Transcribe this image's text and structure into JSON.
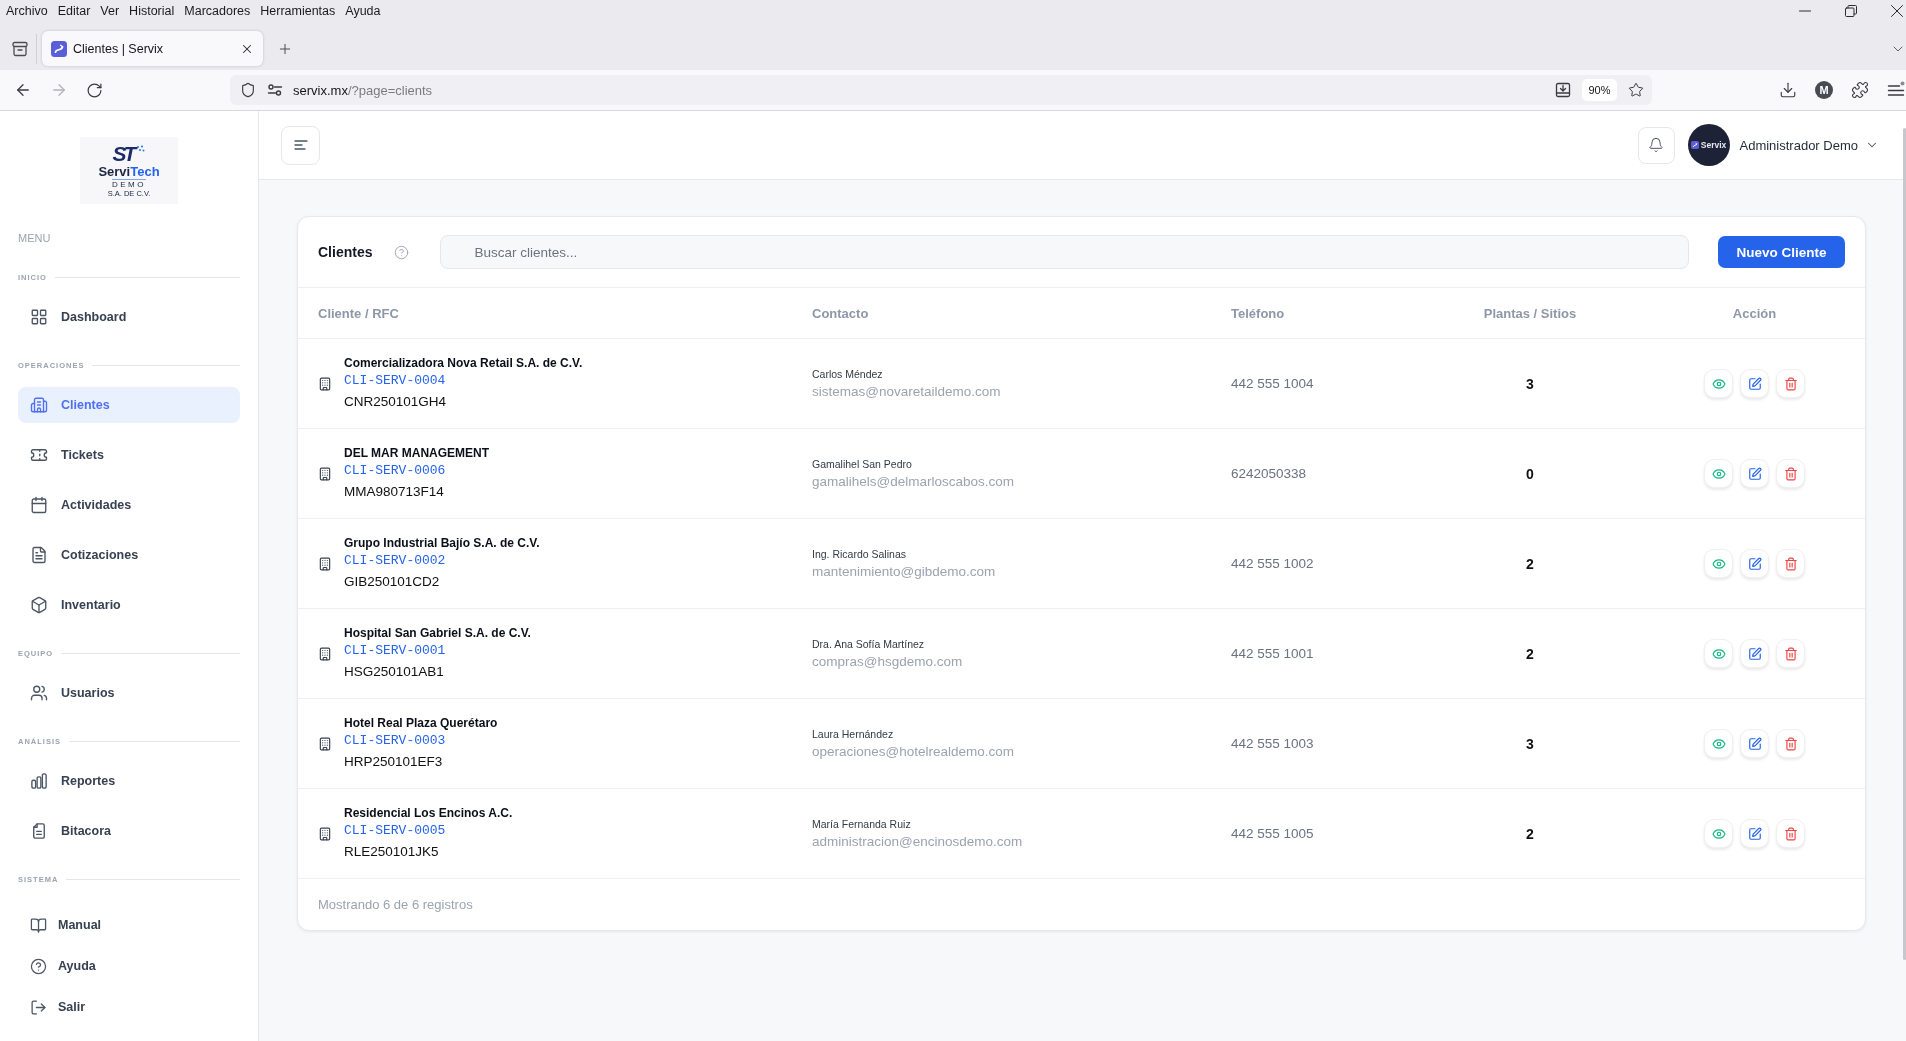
{
  "browser": {
    "menu": [
      "Archivo",
      "Editar",
      "Ver",
      "Historial",
      "Marcadores",
      "Herramientas",
      "Ayuda"
    ],
    "tabs": [
      {
        "title": "Clientes | Servix",
        "selected": true
      }
    ],
    "address": {
      "host": "servix.mx",
      "path": "/?page=clients"
    },
    "zoom": "90%",
    "account_initial": "M"
  },
  "sidebar": {
    "logo": {
      "monogram": "ST",
      "brand_main": "Servi",
      "brand_accent": "Tech",
      "tagline": "DEMO",
      "legal": "S.A. DE C.V."
    },
    "menu_label": "MENU",
    "sections": [
      {
        "title": "INICIO",
        "items": [
          {
            "label": "Dashboard",
            "kind": "nav",
            "selected": false
          }
        ]
      },
      {
        "title": "OPERACIONES",
        "items": [
          {
            "label": "Clientes",
            "kind": "nav",
            "selected": true
          },
          {
            "label": "Tickets",
            "kind": "nav",
            "selected": false
          },
          {
            "label": "Actividades",
            "kind": "nav",
            "selected": false
          },
          {
            "label": "Cotizaciones",
            "kind": "nav",
            "selected": false
          },
          {
            "label": "Inventario",
            "kind": "nav",
            "selected": false
          }
        ]
      },
      {
        "title": "EQUIPO",
        "items": [
          {
            "label": "Usuarios",
            "kind": "nav",
            "selected": false
          }
        ]
      },
      {
        "title": "ANÁLISIS",
        "items": [
          {
            "label": "Reportes",
            "kind": "nav",
            "selected": false
          },
          {
            "label": "Bitacora",
            "kind": "nav",
            "selected": false
          }
        ]
      },
      {
        "title": "SISTEMA",
        "items": [
          {
            "label": "Manual",
            "kind": "link",
            "selected": false
          },
          {
            "label": "Ayuda",
            "kind": "link",
            "selected": false
          },
          {
            "label": "Salir",
            "kind": "link",
            "selected": false
          }
        ]
      }
    ]
  },
  "header": {
    "user": {
      "name": "Administrador Demo",
      "avatar_label": "Servix"
    }
  },
  "clients": {
    "title": "Clientes",
    "search": {
      "placeholder": "Buscar clientes..."
    },
    "new_button": "Nuevo Cliente",
    "columns": [
      "Cliente / RFC",
      "Contacto",
      "Teléfono",
      "Plantas / Sitios",
      "Acción"
    ],
    "rows": [
      {
        "name": "Comercializadora Nova Retail S.A. de C.V.",
        "code": "CLI-SERV-0004",
        "rfc": "CNR250101GH4",
        "contact_name": "Carlos Méndez",
        "contact_email": "sistemas@novaretaildemo.com",
        "phone": "442 555 1004",
        "sites": "3"
      },
      {
        "name": "DEL MAR MANAGEMENT",
        "code": "CLI-SERV-0006",
        "rfc": "MMA980713F14",
        "contact_name": "Gamalihel San Pedro",
        "contact_email": "gamalihels@delmarloscabos.com",
        "phone": "6242050338",
        "sites": "0"
      },
      {
        "name": "Grupo Industrial Bajío S.A. de C.V.",
        "code": "CLI-SERV-0002",
        "rfc": "GIB250101CD2",
        "contact_name": "Ing. Ricardo Salinas",
        "contact_email": "mantenimiento@gibdemo.com",
        "phone": "442 555 1002",
        "sites": "2"
      },
      {
        "name": "Hospital San Gabriel S.A. de C.V.",
        "code": "CLI-SERV-0001",
        "rfc": "HSG250101AB1",
        "contact_name": "Dra. Ana Sofía Martínez",
        "contact_email": "compras@hsgdemo.com",
        "phone": "442 555 1001",
        "sites": "2"
      },
      {
        "name": "Hotel Real Plaza Querétaro",
        "code": "CLI-SERV-0003",
        "rfc": "HRP250101EF3",
        "contact_name": "Laura Hernández",
        "contact_email": "operaciones@hotelrealdemo.com",
        "phone": "442 555 1003",
        "sites": "3"
      },
      {
        "name": "Residencial Los Encinos A.C.",
        "code": "CLI-SERV-0005",
        "rfc": "RLE250101JK5",
        "contact_name": "María Fernanda Ruiz",
        "contact_email": "administracion@encinosdemo.com",
        "phone": "442 555 1005",
        "sites": "2"
      }
    ],
    "footer": "Mostrando 6 de 6 registros"
  }
}
